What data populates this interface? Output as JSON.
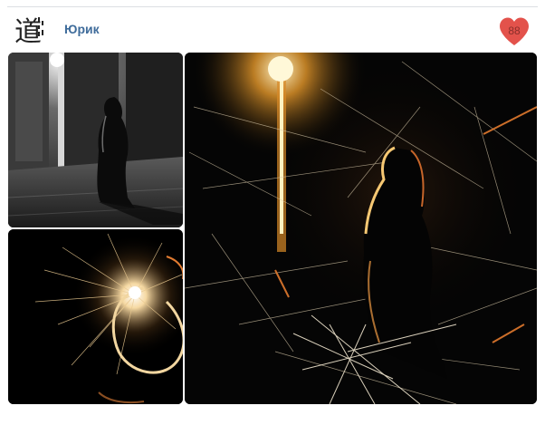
{
  "post": {
    "author_name": "Юрик",
    "avatar_glyph": "道",
    "likes": "88",
    "like_color": "#e3524b",
    "link_color": "#3f6c9b"
  },
  "photos": [
    {
      "name": "dancer-silhouette-photo"
    },
    {
      "name": "sparkler-circle-photo"
    },
    {
      "name": "light-painting-photo"
    }
  ]
}
